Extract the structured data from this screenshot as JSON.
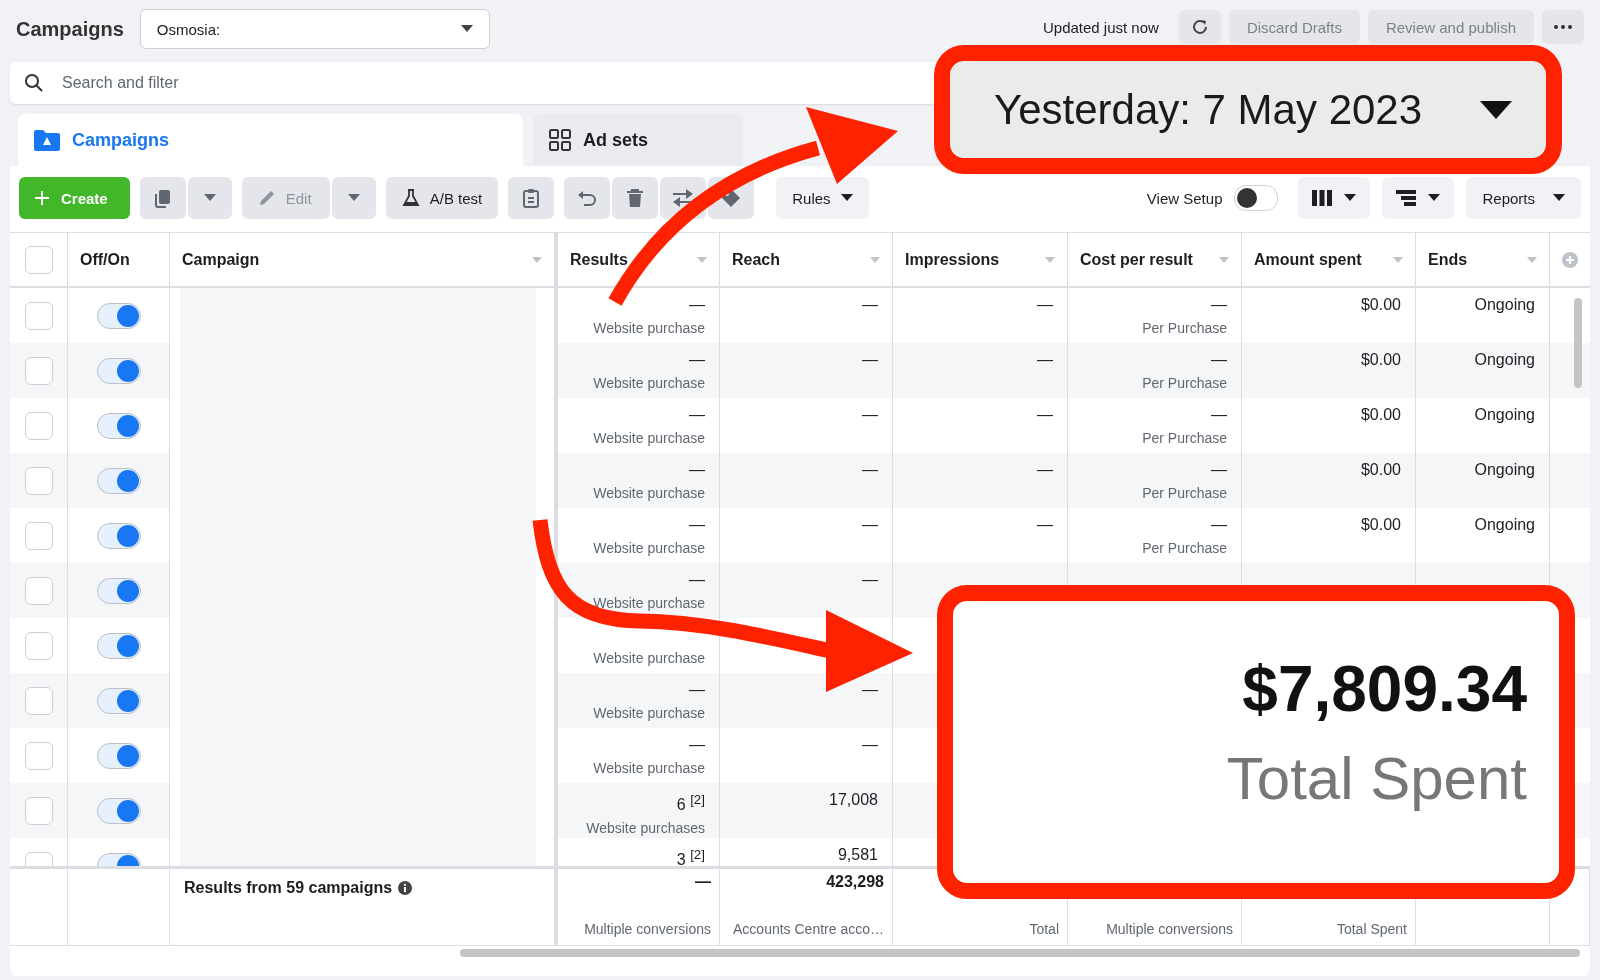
{
  "header": {
    "title": "Campaigns",
    "account": "Osmosia:",
    "status": "Updated just now",
    "buttons": [
      {
        "label": "Discard Drafts",
        "disabled": true
      },
      {
        "label": "Review and publish",
        "disabled": true
      }
    ]
  },
  "search": {
    "placeholder": "Search and filter"
  },
  "tabs": [
    {
      "label": "Campaigns",
      "selected": true
    },
    {
      "label": "Ad sets",
      "selected": false
    }
  ],
  "toolbar": {
    "create": "Create",
    "edit": "Edit",
    "ab_test": "A/B test",
    "rules": "Rules",
    "view_setup": {
      "label": "View Setup",
      "on": false
    },
    "reports": "Reports"
  },
  "table": {
    "header_checked": false,
    "fixed_columns": [
      {
        "label": "Off/On",
        "menu": false
      },
      {
        "label": "Campaign",
        "menu": true
      }
    ],
    "columns": [
      {
        "label": "Results",
        "menu": true
      },
      {
        "label": "Reach",
        "menu": true
      },
      {
        "label": "Impressions",
        "menu": true
      },
      {
        "label": "Cost per result",
        "menu": true
      },
      {
        "label": "Amount spent",
        "menu": true
      },
      {
        "label": "Ends",
        "menu": true
      }
    ],
    "rows": [
      {
        "checked": false,
        "on": true,
        "cells": [
          {
            "value": "—",
            "label": "Website purchase"
          },
          {
            "value": "—"
          },
          {
            "value": "—"
          },
          {
            "value": "—",
            "label": "Per Purchase"
          },
          {
            "value": "$0.00"
          },
          {
            "value": "Ongoing"
          }
        ]
      },
      {
        "checked": false,
        "on": true,
        "cells": [
          {
            "value": "—",
            "label": "Website purchase"
          },
          {
            "value": "—"
          },
          {
            "value": "—"
          },
          {
            "value": "—",
            "label": "Per Purchase"
          },
          {
            "value": "$0.00"
          },
          {
            "value": "Ongoing"
          }
        ]
      },
      {
        "checked": false,
        "on": true,
        "cells": [
          {
            "value": "—",
            "label": "Website purchase"
          },
          {
            "value": "—"
          },
          {
            "value": "—"
          },
          {
            "value": "—",
            "label": "Per Purchase"
          },
          {
            "value": "$0.00"
          },
          {
            "value": "Ongoing"
          }
        ]
      },
      {
        "checked": false,
        "on": true,
        "cells": [
          {
            "value": "—",
            "label": "Website purchase"
          },
          {
            "value": "—"
          },
          {
            "value": "—"
          },
          {
            "value": "—",
            "label": "Per Purchase"
          },
          {
            "value": "$0.00"
          },
          {
            "value": "Ongoing"
          }
        ]
      },
      {
        "checked": false,
        "on": true,
        "cells": [
          {
            "value": "—",
            "label": "Website purchase"
          },
          {
            "value": "—"
          },
          {
            "value": "—"
          },
          {
            "value": "—",
            "label": "Per Purchase"
          },
          {
            "value": "$0.00"
          },
          {
            "value": "Ongoing"
          }
        ]
      },
      {
        "checked": false,
        "on": true,
        "cells": [
          {
            "value": "—",
            "label": "Website purchase"
          },
          {
            "value": "—"
          },
          null,
          null,
          null,
          null
        ]
      },
      {
        "checked": false,
        "on": true,
        "cells": [
          {
            "label": "Website purchase"
          },
          null,
          null,
          null,
          null,
          null
        ]
      },
      {
        "checked": false,
        "on": true,
        "cells": [
          {
            "value": "—",
            "label": "Website purchase"
          },
          {
            "value": "—"
          },
          null,
          null,
          null,
          null
        ]
      },
      {
        "checked": false,
        "on": true,
        "cells": [
          {
            "value": "—",
            "label": "Website purchase"
          },
          {
            "value": "—"
          },
          null,
          null,
          null,
          null
        ]
      },
      {
        "checked": false,
        "on": true,
        "cells": [
          {
            "value": "6 $^{[2]}$",
            "label": "Website purchases"
          },
          {
            "value": "17,008"
          },
          null,
          null,
          null,
          null
        ]
      },
      {
        "checked": false,
        "on": true,
        "cells": [
          {
            "value": "3 $^{[2]}$"
          },
          {
            "value": "9,581"
          },
          null,
          null,
          null,
          null
        ]
      }
    ],
    "footer": {
      "label": "Results from 59 campaigns",
      "cells": [
        {
          "value": "—",
          "label": "Multiple conversions"
        },
        {
          "value": "423,298",
          "label": "Accounts Centre acco…"
        },
        {
          "label": "Total"
        },
        {
          "label": "Multiple conversions"
        },
        {
          "label": "Total Spent"
        },
        null
      ]
    }
  },
  "callouts": {
    "date": "Yesterday: 7 May 2023",
    "total": {
      "value": "$7,809.34",
      "label": "Total Spent"
    }
  }
}
